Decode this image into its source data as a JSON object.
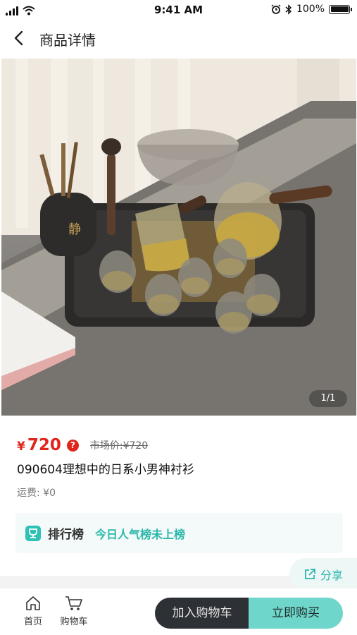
{
  "status_bar": {
    "time": "9:41 AM",
    "battery": "100%"
  },
  "nav": {
    "title": "商品详情"
  },
  "gallery": {
    "counter": "1/1"
  },
  "product": {
    "price_currency": "¥",
    "price_value": "720",
    "market_price": "市场价:¥720",
    "title": "090604理想中的日系小男神衬衫",
    "shipping": "运费: ¥0"
  },
  "ranking": {
    "label": "排行榜",
    "text": "今日人气榜未上榜"
  },
  "share": {
    "label": "分享"
  },
  "bottom_bar": {
    "home_label": "首页",
    "cart_label": "购物车",
    "add_to_cart": "加入购物车",
    "buy_now": "立即购买"
  },
  "colors": {
    "price": "#e0251d",
    "accent": "#2bb7aa",
    "buy_button": "#6fd6cb",
    "cart_button": "#2d3034"
  }
}
